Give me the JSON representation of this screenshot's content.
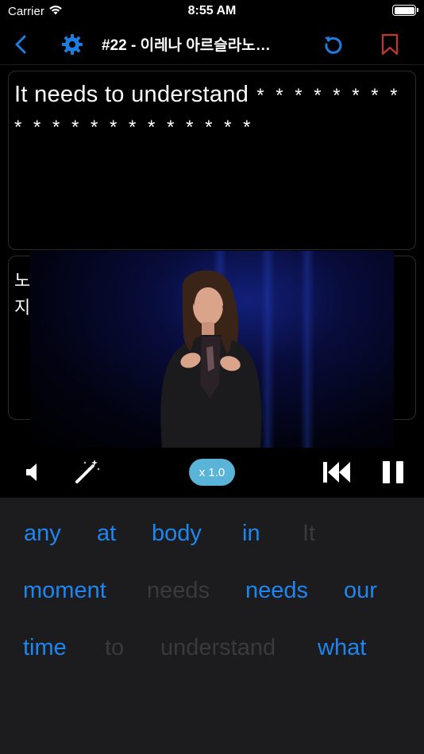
{
  "status_bar": {
    "carrier": "Carrier",
    "time": "8:55 AM"
  },
  "nav": {
    "title": "#22 - 이레나 아르슬라노…",
    "icons": {
      "back": "chevron-left-icon",
      "settings": "gear-icon",
      "reset": "rotate-ccw-icon",
      "bookmark": "bookmark-icon"
    },
    "colors": {
      "accent": "#1e7de0",
      "bookmark": "#c0392b"
    }
  },
  "sentence": {
    "english_revealed": "It needs to understand",
    "english_mask_line1": "* * * * * * * *",
    "english_mask_line2": "* * * * * * * * * * * * *",
    "korean_chars": [
      "노",
      "지"
    ]
  },
  "controls": {
    "speed": "x 1.0",
    "icons": {
      "volume": "speaker-icon",
      "hint": "magic-wand-icon",
      "rewind": "skip-back-icon",
      "pause": "pause-icon"
    }
  },
  "word_bank": {
    "rows": [
      [
        {
          "text": "any",
          "used": false
        },
        {
          "text": "at",
          "used": false
        },
        {
          "text": "body",
          "used": false
        },
        {
          "text": "in",
          "used": false
        },
        {
          "text": "It",
          "used": true
        }
      ],
      [
        {
          "text": "moment",
          "used": false
        },
        {
          "text": "needs",
          "used": true
        },
        {
          "text": "needs",
          "used": false
        },
        {
          "text": "our",
          "used": false
        }
      ],
      [
        {
          "text": "time",
          "used": false
        },
        {
          "text": "to",
          "used": true
        },
        {
          "text": "understand",
          "used": true
        },
        {
          "text": "what",
          "used": false
        }
      ]
    ],
    "colors": {
      "available": "#1e86f0",
      "used": "#3a3a3c"
    }
  }
}
